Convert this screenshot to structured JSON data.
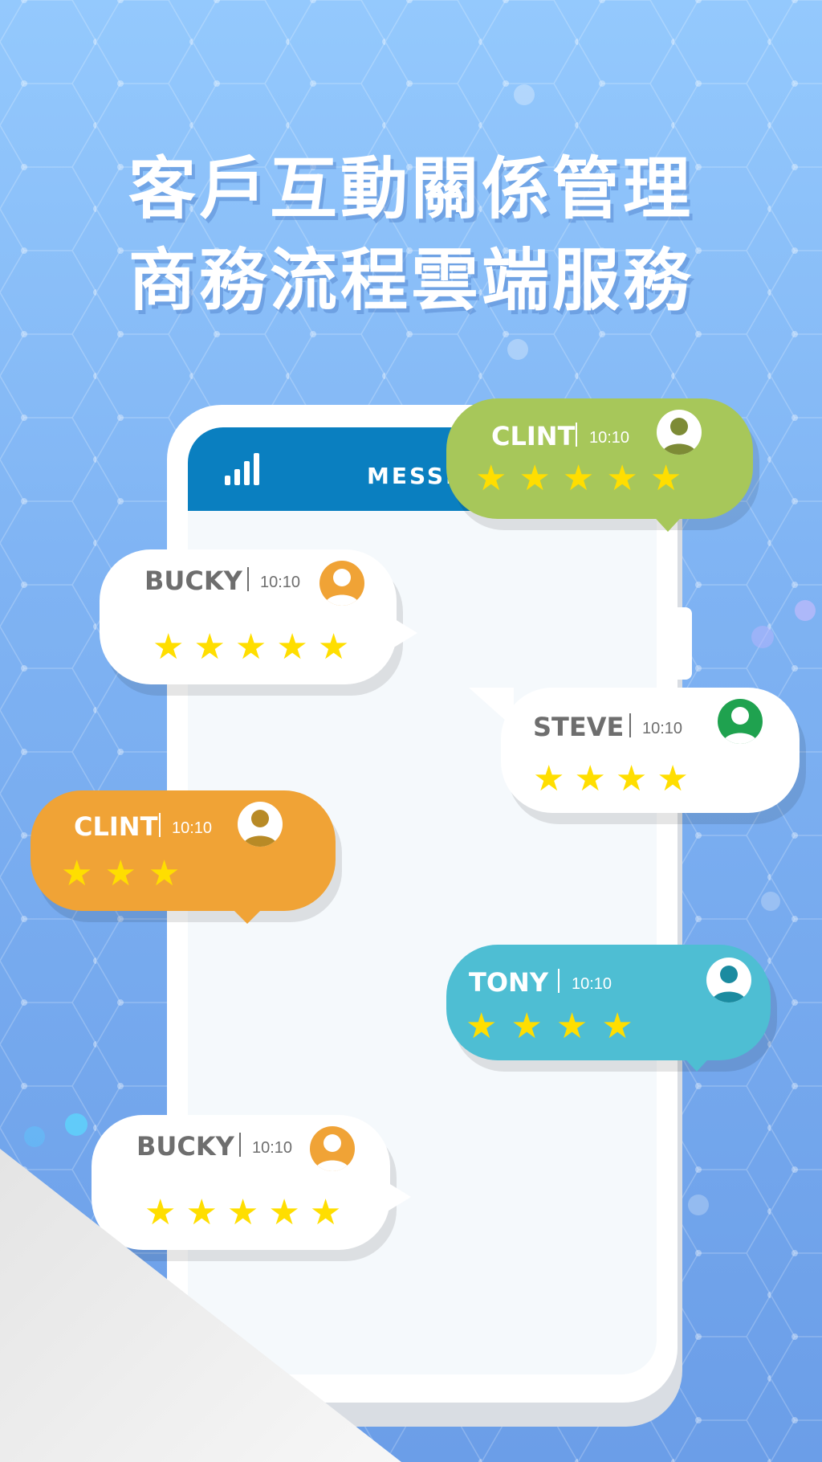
{
  "headline": {
    "line1": "客戶互動關係管理",
    "line2": "商務流程雲端服務"
  },
  "phone": {
    "header_title": "MESSENGER"
  },
  "colors": {
    "green": "#a7c75a",
    "orange": "#f0a336",
    "teal": "#4ebed3",
    "white": "#ffffff",
    "star": "#ffde00",
    "header": "#0a7fc0"
  },
  "bubbles": [
    {
      "name": "CLINT",
      "time": "10:10",
      "stars": 5,
      "color": "green",
      "avatar": "person-icon"
    },
    {
      "name": "BUCKY",
      "time": "10:10",
      "stars": 5,
      "color": "white",
      "avatar": "person-icon"
    },
    {
      "name": "STEVE",
      "time": "10:10",
      "stars": 4,
      "color": "white",
      "avatar": "person-icon"
    },
    {
      "name": "CLINT",
      "time": "10:10",
      "stars": 3,
      "color": "orange",
      "avatar": "person-icon"
    },
    {
      "name": "TONY",
      "time": "10:10",
      "stars": 4,
      "color": "teal",
      "avatar": "person-icon"
    },
    {
      "name": "BUCKY",
      "time": "10:10",
      "stars": 5,
      "color": "white",
      "avatar": "person-icon"
    }
  ]
}
